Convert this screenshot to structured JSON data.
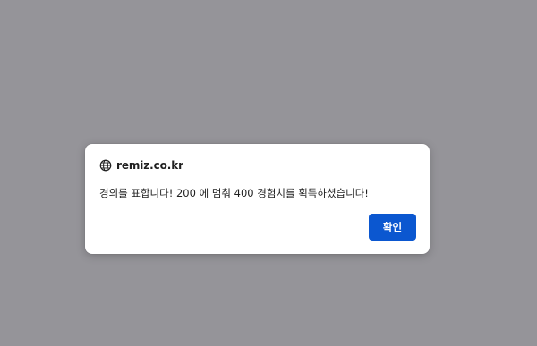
{
  "page": {
    "overlay_color": "#959499"
  },
  "dialog": {
    "origin": "remiz.co.kr",
    "origin_icon": "globe-icon",
    "message": "경의를 표합니다! 200 에 멈춰 400 경험치를 획득하셨습니다!",
    "ok_label": "확인",
    "button_color": "#0b57d0"
  }
}
